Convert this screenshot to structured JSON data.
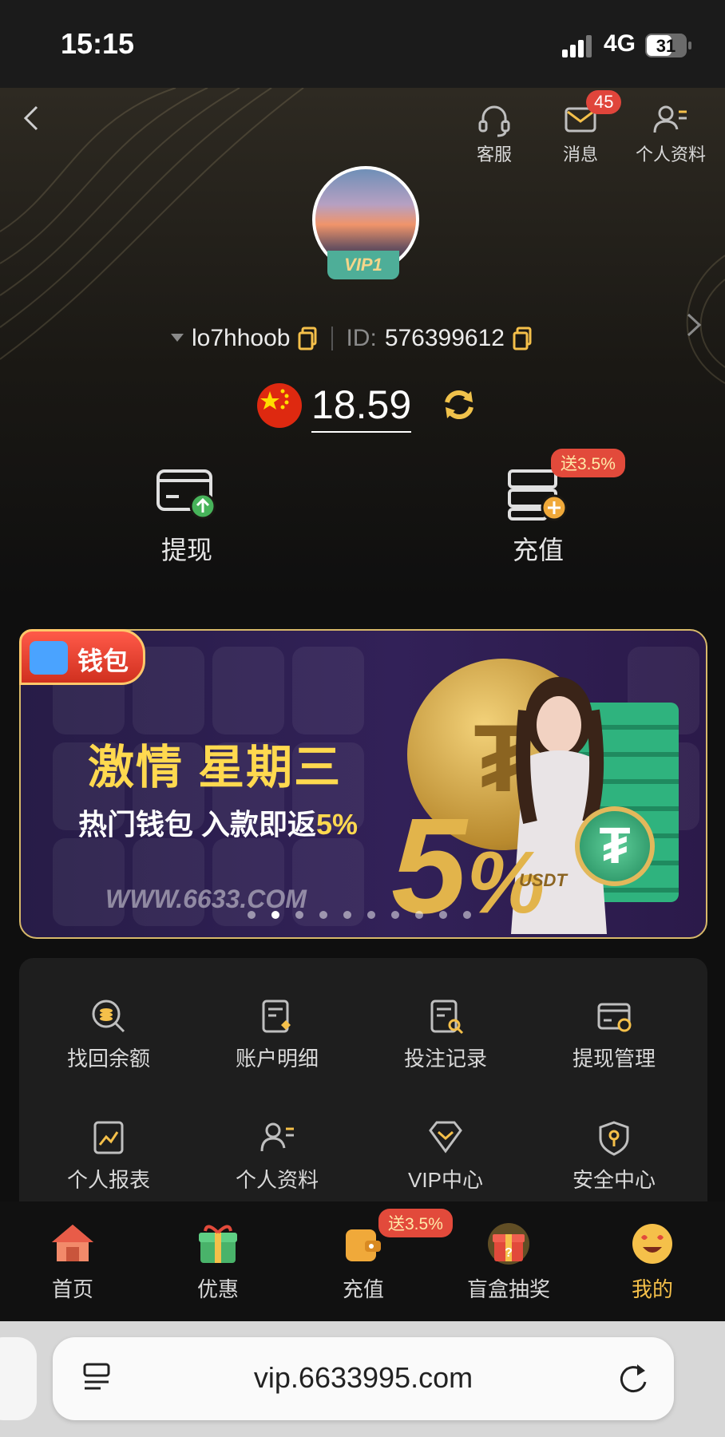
{
  "status_bar": {
    "time": "15:15",
    "network": "4G",
    "battery": "31"
  },
  "header": {
    "top_actions": [
      {
        "label": "客服",
        "icon": "headset-icon"
      },
      {
        "label": "消息",
        "icon": "mail-icon",
        "badge": "45"
      },
      {
        "label": "个人资料",
        "icon": "profile-card-icon"
      }
    ],
    "vip_level": "VIP1",
    "username": "lo7hhoob",
    "id_label": "ID:",
    "id_value": "576399612",
    "balance": "18.59"
  },
  "actions": [
    {
      "label": "提现",
      "icon": "withdraw-icon"
    },
    {
      "label": "充值",
      "icon": "deposit-icon",
      "promo": "送3.5%"
    }
  ],
  "banner": {
    "tag": "钱包",
    "title": "激情 星期三",
    "subtitle_main": "热门钱包 入款即返",
    "subtitle_highlight": "5%",
    "url": "WWW.6633.COM",
    "big_number": "5",
    "big_percent": "%",
    "coin_label": "USDT",
    "slide_count": 10,
    "active_slide": 1
  },
  "grid": [
    {
      "label": "找回余额",
      "icon": "coin-search-icon"
    },
    {
      "label": "账户明细",
      "icon": "account-detail-icon"
    },
    {
      "label": "投注记录",
      "icon": "bet-record-icon"
    },
    {
      "label": "提现管理",
      "icon": "withdraw-manage-icon"
    },
    {
      "label": "个人报表",
      "icon": "report-chart-icon"
    },
    {
      "label": "个人资料",
      "icon": "profile-icon"
    },
    {
      "label": "VIP中心",
      "icon": "vip-diamond-icon"
    },
    {
      "label": "安全中心",
      "icon": "security-shield-icon"
    }
  ],
  "tabbar": [
    {
      "label": "首页",
      "icon": "home-icon"
    },
    {
      "label": "优惠",
      "icon": "gift-icon"
    },
    {
      "label": "充值",
      "icon": "wallet-icon",
      "promo": "送3.5%"
    },
    {
      "label": "盲盒抽奖",
      "icon": "mystery-box-icon"
    },
    {
      "label": "我的",
      "icon": "smiley-icon",
      "active": true
    }
  ],
  "browser": {
    "url": "vip.6633995.com"
  },
  "colors": {
    "accent_gold": "#f5c04a",
    "promo_red": "#e24a3b",
    "vip_green": "#4eae98"
  }
}
